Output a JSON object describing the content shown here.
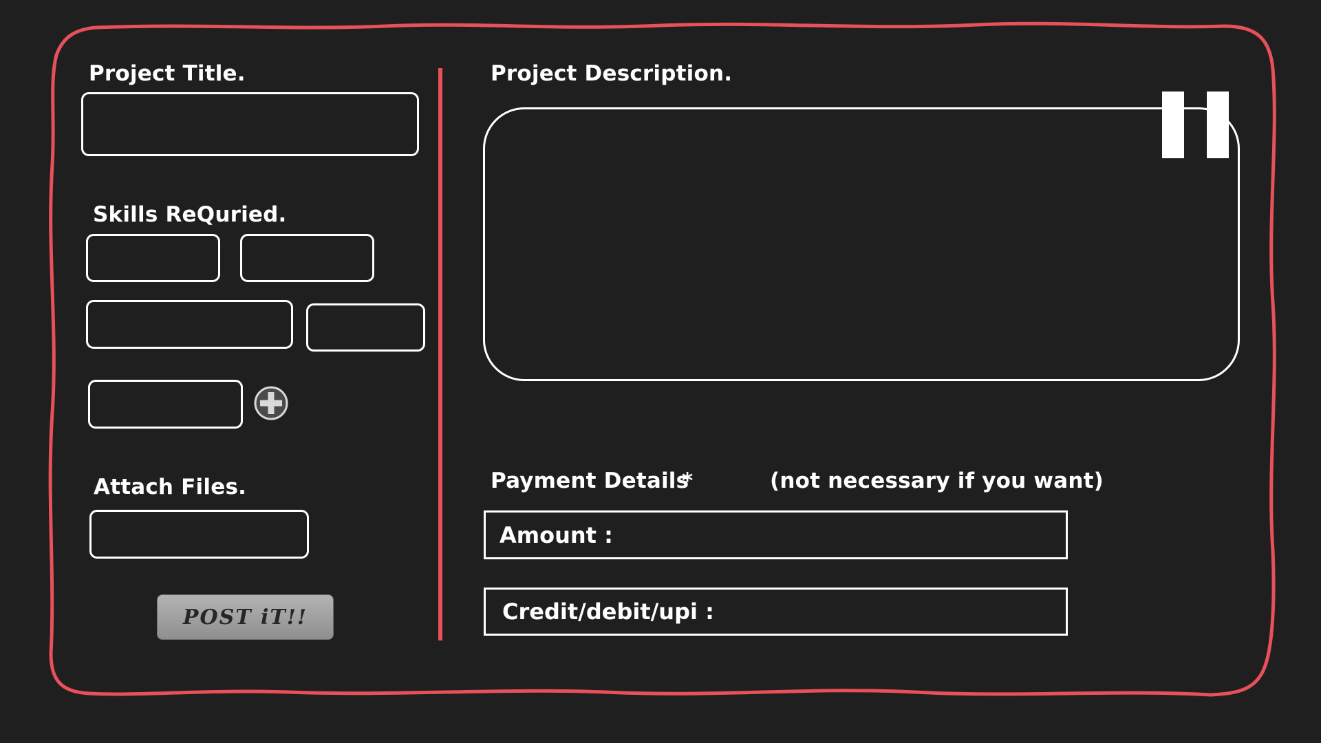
{
  "colors": {
    "background": "#1f1f1f",
    "accent_border": "#e8505a",
    "field_border": "#ffffff",
    "button_fill": "#a0a0a0"
  },
  "project_title": {
    "label": "Project Title.",
    "value": ""
  },
  "skills": {
    "label": "Skills ReQuried.",
    "fields": [
      "",
      "",
      "",
      "",
      ""
    ],
    "add_icon": "plus-circle-icon"
  },
  "attach_files": {
    "label": "Attach Files.",
    "value": ""
  },
  "post_button": {
    "label": "POST iT!!"
  },
  "project_description": {
    "label": "Project Description.",
    "value": "",
    "corner_icon": "pause-icon"
  },
  "payment": {
    "label": "Payment Details",
    "required_mark": "*",
    "note": "(not necessary if you want)",
    "amount_label": "Amount :",
    "method_label": "Credit/debit/upi :"
  }
}
